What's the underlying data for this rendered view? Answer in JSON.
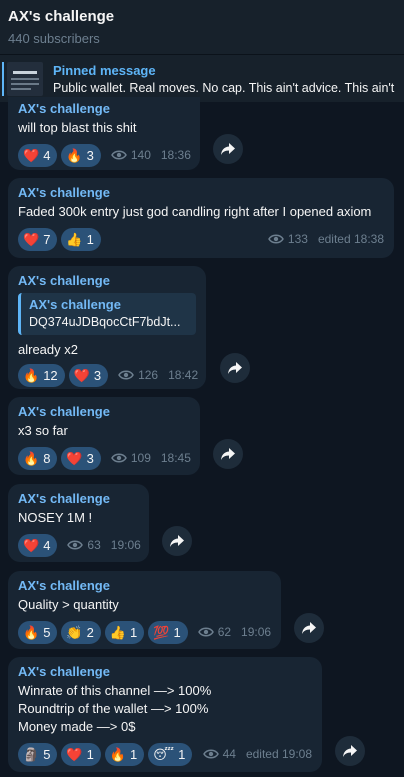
{
  "header": {
    "title": "AX's challenge",
    "subscribers": "440 subscribers"
  },
  "pinned": {
    "label": "Pinned message",
    "text": "Public wallet. Real moves. No cap.  This ain't advice. This ain't"
  },
  "messages": [
    {
      "author": "AX's challenge",
      "lines": [
        "will top blast this shit"
      ],
      "reactions": [
        {
          "emoji": "❤️",
          "count": "4"
        },
        {
          "emoji": "🔥",
          "count": "3"
        }
      ],
      "views": "140",
      "time": "18:36"
    },
    {
      "author": "AX's challenge",
      "lines": [
        "Faded 300k entry just god candling right after I opened axiom"
      ],
      "reactions": [
        {
          "emoji": "❤️",
          "count": "7"
        },
        {
          "emoji": "👍",
          "count": "1"
        }
      ],
      "views": "133",
      "time": "edited 18:38"
    },
    {
      "author": "AX's challenge",
      "reply": {
        "author": "AX's challenge",
        "text": "DQ374uJDBqocCtF7bdJt..."
      },
      "lines": [
        "already x2"
      ],
      "reactions": [
        {
          "emoji": "🔥",
          "count": "12"
        },
        {
          "emoji": "❤️",
          "count": "3"
        }
      ],
      "views": "126",
      "time": "18:42"
    },
    {
      "author": "AX's challenge",
      "lines": [
        "x3 so far"
      ],
      "reactions": [
        {
          "emoji": "🔥",
          "count": "8"
        },
        {
          "emoji": "❤️",
          "count": "3"
        }
      ],
      "views": "109",
      "time": "18:45"
    },
    {
      "author": "AX's challenge",
      "lines": [
        "NOSEY 1M !"
      ],
      "reactions": [
        {
          "emoji": "❤️",
          "count": "4"
        }
      ],
      "views": "63",
      "time": "19:06"
    },
    {
      "author": "AX's challenge",
      "lines": [
        "Quality > quantity"
      ],
      "reactions": [
        {
          "emoji": "🔥",
          "count": "5"
        },
        {
          "emoji": "👏",
          "count": "2"
        },
        {
          "emoji": "👍",
          "count": "1"
        },
        {
          "emoji": "💯",
          "count": "1"
        }
      ],
      "views": "62",
      "time": "19:06"
    },
    {
      "author": "AX's challenge",
      "lines": [
        "Winrate of this channel —> 100%",
        "Roundtrip of the wallet —> 100%",
        "Money made —> 0$"
      ],
      "reactions": [
        {
          "emoji": "🗿",
          "count": "5"
        },
        {
          "emoji": "❤️",
          "count": "1"
        },
        {
          "emoji": "🔥",
          "count": "1"
        },
        {
          "emoji": "😴",
          "count": "1"
        }
      ],
      "views": "44",
      "time": "edited 19:08"
    }
  ],
  "colors": {
    "background": "#0e1621",
    "bubble": "#182533",
    "accent": "#73b9f5",
    "reaction": "#2b5278",
    "meta": "#6d7f8f"
  },
  "icons": {
    "views": "eye-icon",
    "share": "share-arrow-icon",
    "pinned_thumb": "pinned-thumbnail"
  }
}
